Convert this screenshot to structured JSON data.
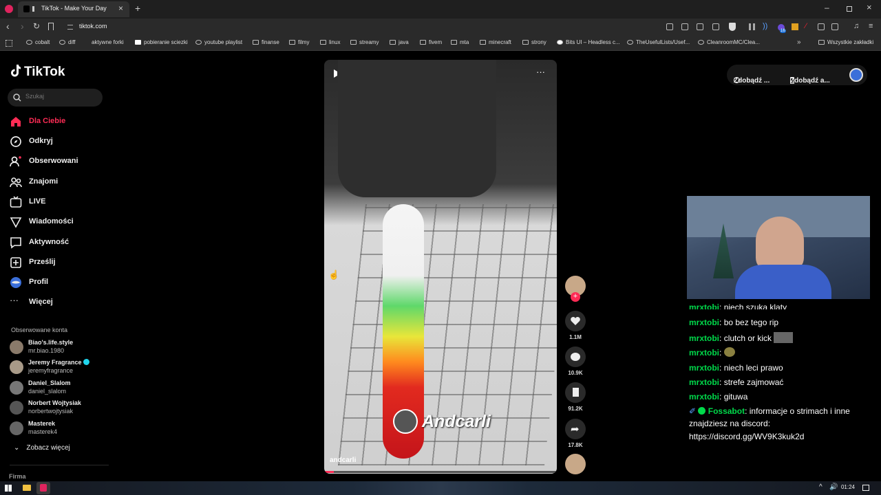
{
  "browser": {
    "tab_title": "TikTok - Make Your Day",
    "url": "tiktok.com",
    "bookmarks": [
      "cobalt",
      "diff",
      "aktywne forki",
      "pobieranie sciezki",
      "youtube playlist",
      "finanse",
      "filmy",
      "linux",
      "streamy",
      "java",
      "fivem",
      "mta",
      "minecraft",
      "strony",
      "Bits UI – Headless c...",
      "TheUsefulLists/Usef...",
      "CleanroomMC/Clea..."
    ],
    "all_bookmarks": "Wszystkie zakładki",
    "extension_badge": "16"
  },
  "tiktok": {
    "logo": "TikTok",
    "search_placeholder": "Szukaj",
    "nav": [
      {
        "label": "Dla Ciebie",
        "icon": "home-icon"
      },
      {
        "label": "Odkryj",
        "icon": "compass-icon"
      },
      {
        "label": "Obserwowani",
        "icon": "following-icon"
      },
      {
        "label": "Znajomi",
        "icon": "friends-icon"
      },
      {
        "label": "LIVE",
        "icon": "live-icon"
      },
      {
        "label": "Wiadomości",
        "icon": "messages-icon"
      },
      {
        "label": "Aktywność",
        "icon": "activity-icon"
      },
      {
        "label": "Prześlij",
        "icon": "upload-icon"
      },
      {
        "label": "Profil",
        "icon": "profile-icon"
      },
      {
        "label": "Więcej",
        "icon": "more-icon"
      }
    ],
    "followed_title": "Obserwowane konta",
    "accounts": [
      {
        "name": "Biao's.life.style",
        "handle": "mr.biao.1980"
      },
      {
        "name": "Jeremy Fragrance",
        "handle": "jeremyfragrance",
        "verified": true
      },
      {
        "name": "Daniel_Slalom",
        "handle": "daniel_slalom"
      },
      {
        "name": "Norbert Wojtysiak",
        "handle": "norbertwojtysiak"
      },
      {
        "name": "Masterek",
        "handle": "masterek4"
      }
    ],
    "see_more": "Zobacz więcej",
    "footer": "Firma",
    "video": {
      "author": "andcarli",
      "watermark": "Andcarli"
    },
    "actions": {
      "likes": "1.1M",
      "comments": "10.9K",
      "saves": "91.2K",
      "shares": "17.8K"
    },
    "top_right": {
      "get1": "Zdobądź ...",
      "get2": "Zdobądź a..."
    }
  },
  "chat": [
    {
      "user": "mrxtobi",
      "text": "niech szuka klaty"
    },
    {
      "user": "mrxtobi",
      "text": "bo bez tego rip"
    },
    {
      "user": "mrxtobi",
      "text": "clutch or kick"
    },
    {
      "user": "mrxtobi",
      "text": ""
    },
    {
      "user": "mrxtobi",
      "text": "niech leci prawo"
    },
    {
      "user": "mrxtobi",
      "text": "strefe zajmować"
    },
    {
      "user": "mrxtobi",
      "text": "gituwa"
    },
    {
      "user": "Fossabot",
      "text": "informacje o strimach i inne"
    },
    {
      "user": "",
      "text": "znajdziesz na discord:"
    },
    {
      "user": "",
      "text": "https://discord.gg/WV9K3kuk2d"
    }
  ],
  "taskbar": {
    "time": "01:24"
  },
  "colors": {
    "accent": "#fe2c55",
    "chat_user": "#00d94a"
  }
}
